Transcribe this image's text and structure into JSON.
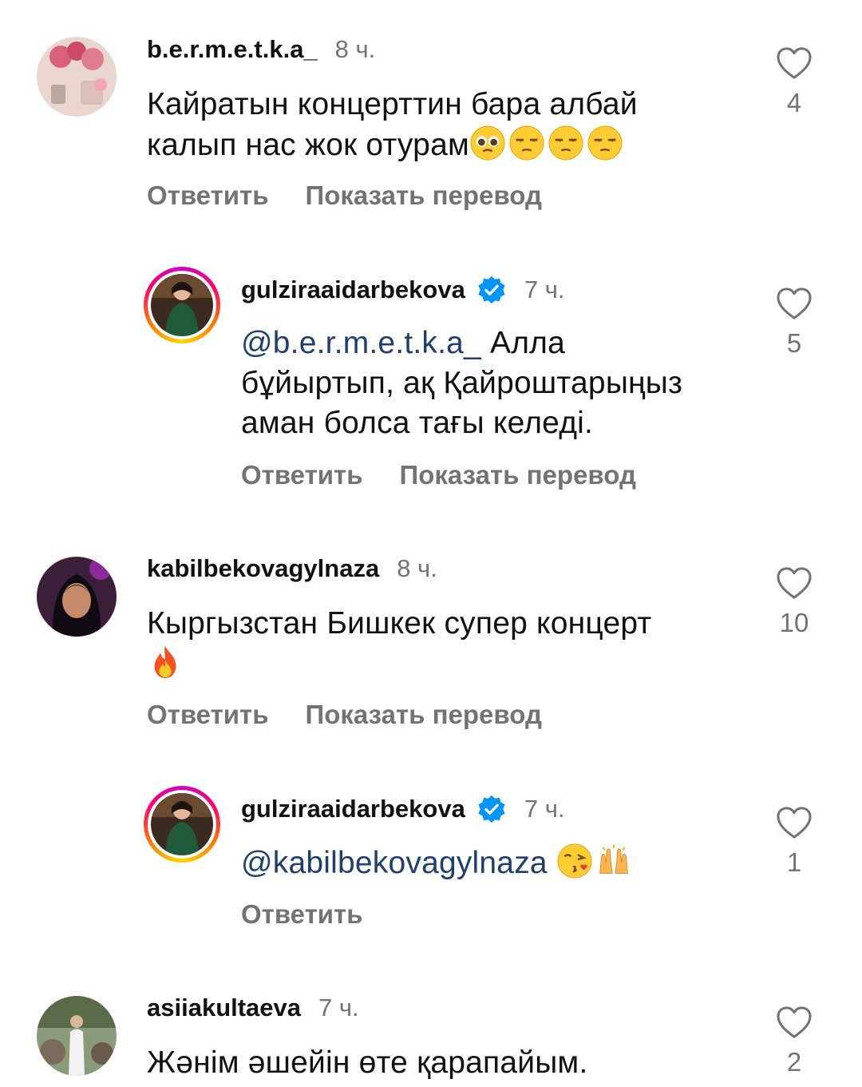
{
  "comments": [
    {
      "username": "b.e.r.m.e.t.k.a_",
      "time": "8 ч.",
      "text_line1": "Кайратын концерттин бара албай",
      "text_line2": "калып нас жок отурам",
      "emojis": [
        "pleading-face",
        "unamused-face",
        "unamused-face",
        "unamused-face"
      ],
      "reply": "Ответить",
      "translate": "Показать перевод",
      "likes": "4"
    },
    {
      "username": "gulziraaidarbekova",
      "verified": true,
      "time": "7 ч.",
      "mention": "@b.e.r.m.e.t.k.a_",
      "text_line1": " Алла",
      "text_line2": "бұйыртып, ақ Қайроштарыңыз",
      "text_line3": "аман болса тағы келеді.",
      "reply": "Ответить",
      "translate": "Показать перевод",
      "likes": "5"
    },
    {
      "username": "kabilbekovagylnaza",
      "time": "8 ч.",
      "text_line1": "Кыргызстан Бишкек супер концерт",
      "emojis": [
        "fire"
      ],
      "reply": "Ответить",
      "translate": "Показать перевод",
      "likes": "10"
    },
    {
      "username": "gulziraaidarbekova",
      "verified": true,
      "time": "7 ч.",
      "mention": "@kabilbekovagylnaza",
      "emojis": [
        "face-blowing-kiss",
        "raising-hands"
      ],
      "reply": "Ответить",
      "likes": "1"
    },
    {
      "username": "asiiakultaeva",
      "time": "7 ч.",
      "text_line1": "Жәнім әшейін өте қарапайым.",
      "likes": "2"
    }
  ],
  "colors": {
    "text": "#111111",
    "secondary": "#737373",
    "mention": "#1f3f6e",
    "verified": "#0095f6"
  }
}
